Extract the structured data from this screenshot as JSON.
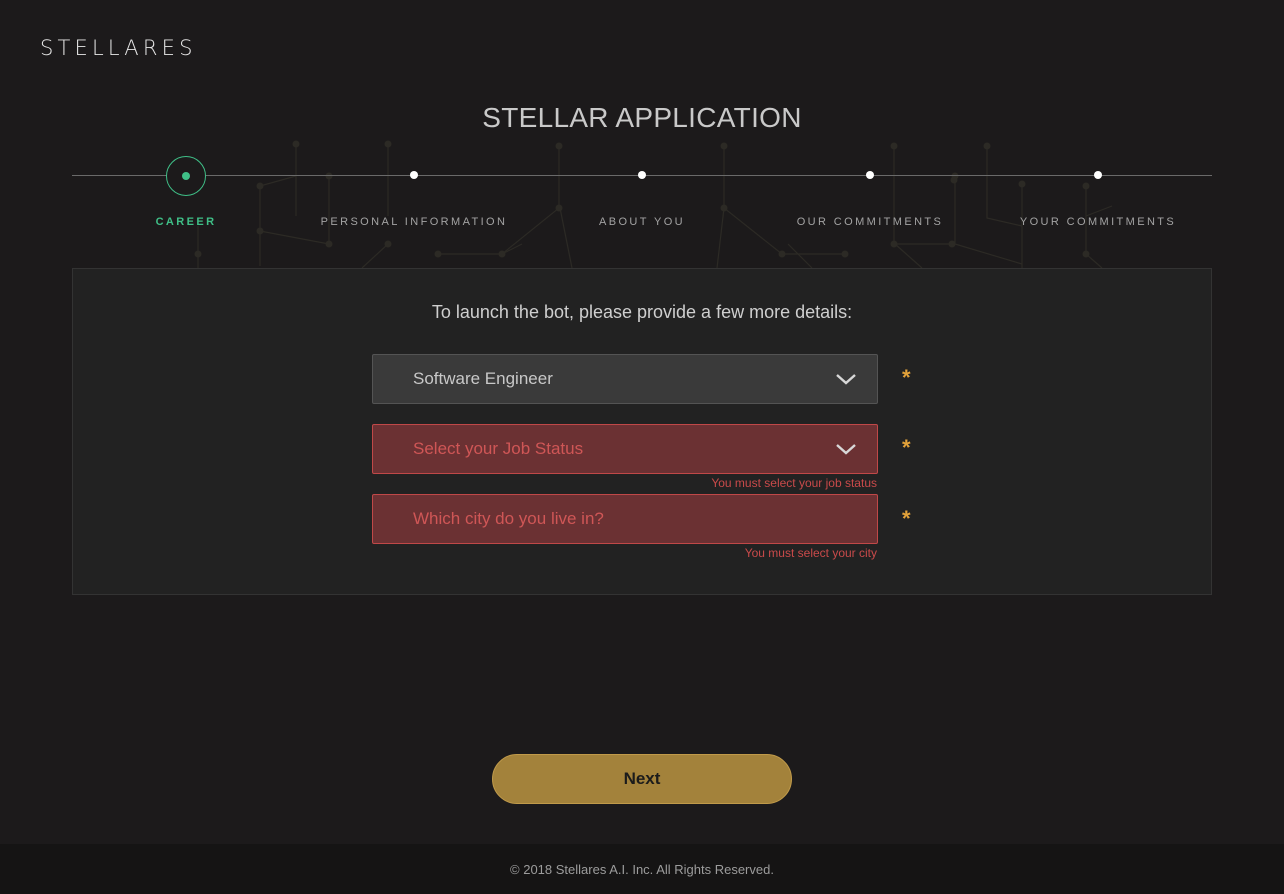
{
  "brand": {
    "logo_text": "STELLARES"
  },
  "header": {
    "title": "STELLAR APPLICATION"
  },
  "stepper": {
    "steps": [
      {
        "label": "CAREER",
        "active": true
      },
      {
        "label": "PERSONAL INFORMATION",
        "active": false
      },
      {
        "label": "ABOUT YOU",
        "active": false
      },
      {
        "label": "OUR COMMITMENTS",
        "active": false
      },
      {
        "label": "YOUR COMMITMENTS",
        "active": false
      }
    ],
    "active_color": "#3fbf87"
  },
  "form": {
    "intro": "To launch the bot, please provide a few more details:",
    "career_select": {
      "value": "Software Engineer",
      "required_mark": "*"
    },
    "job_status_select": {
      "placeholder": "Select your Job Status",
      "required_mark": "*",
      "error": "You must select your job status"
    },
    "city_input": {
      "placeholder": "Which city do you live in?",
      "required_mark": "*",
      "error": "You must select your city"
    }
  },
  "actions": {
    "next_label": "Next"
  },
  "footer": {
    "copyright": "© 2018 Stellares A.I. Inc. All Rights Reserved."
  },
  "colors": {
    "background": "#1c1a1b",
    "accent_green": "#3fbf87",
    "error_red": "#c04848",
    "required_orange": "#e3a23a",
    "button_gold": "#a3823b"
  },
  "icons": {
    "dropdown": "chevron-down-icon",
    "step_active": "circle-dot-icon",
    "step": "dot-icon"
  }
}
